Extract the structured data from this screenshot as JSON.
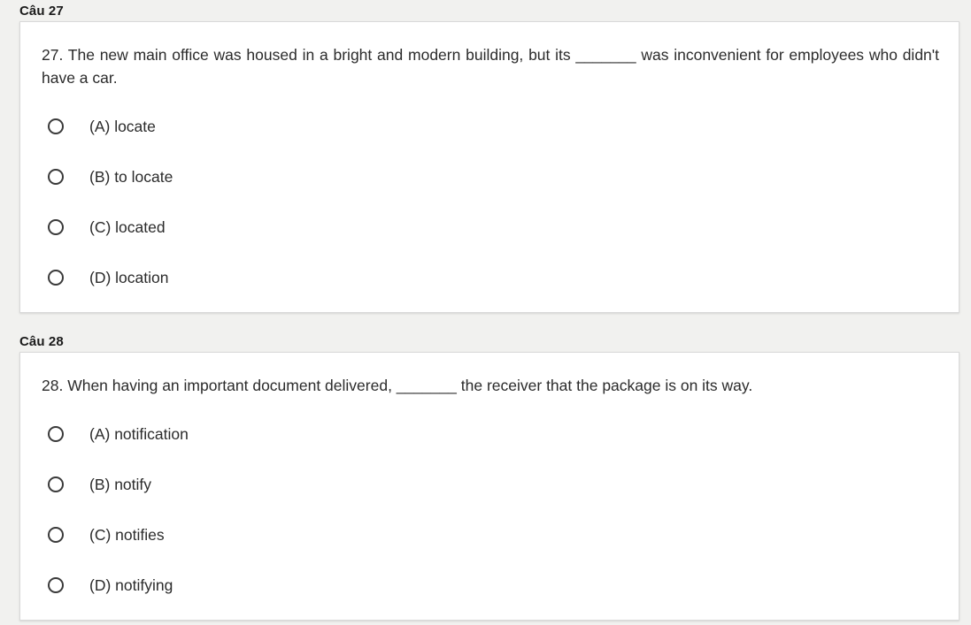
{
  "questions": [
    {
      "section_label": "Câu 27",
      "text": "27. The new main office was housed in a bright and modern building, but its _______ was inconvenient for employees who didn't have a car.",
      "options": [
        {
          "label": "(A) locate"
        },
        {
          "label": "(B) to locate"
        },
        {
          "label": "(C) located"
        },
        {
          "label": "(D) location"
        }
      ]
    },
    {
      "section_label": "Câu 28",
      "text": "28. When having an important document delivered, _______ the receiver that the package is on its way.",
      "options": [
        {
          "label": "(A) notification"
        },
        {
          "label": "(B) notify"
        },
        {
          "label": "(C) notifies"
        },
        {
          "label": "(D) notifying"
        }
      ]
    }
  ]
}
